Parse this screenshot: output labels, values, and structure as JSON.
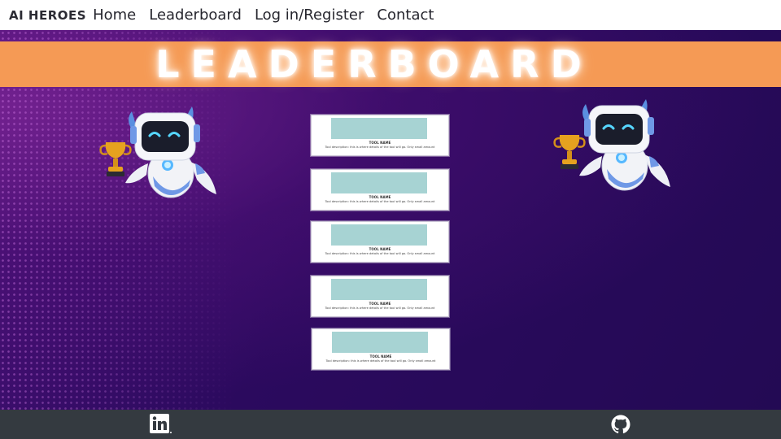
{
  "nav": {
    "brand": "AI HEROES",
    "links": [
      "Home",
      "Leaderboard",
      "Log in/Register",
      "Contact"
    ]
  },
  "banner": {
    "title": "LEADERBOARD"
  },
  "cards": [
    {
      "name": "TOOL NAME",
      "description": "Tool description: this is where details of the tool will go. Only small amount"
    },
    {
      "name": "TOOL NAME",
      "description": "Tool description: this is where details of the tool will go. Only small amount"
    },
    {
      "name": "TOOL NAME",
      "description": "Tool description: this is where details of the tool will go. Only small amount"
    },
    {
      "name": "TOOL NAME",
      "description": "Tool description: this is where details of the tool will go. Only small amount"
    },
    {
      "name": "TOOL NAME",
      "description": "Tool description: this is where details of the tool will go. Only small amount"
    }
  ],
  "footer": {
    "icons": [
      "linkedin-icon",
      "github-icon"
    ]
  },
  "colors": {
    "banner": "#f59a55",
    "background": "#2a0a4e",
    "footer": "#343a40",
    "card_image": "#a7d3d3"
  }
}
